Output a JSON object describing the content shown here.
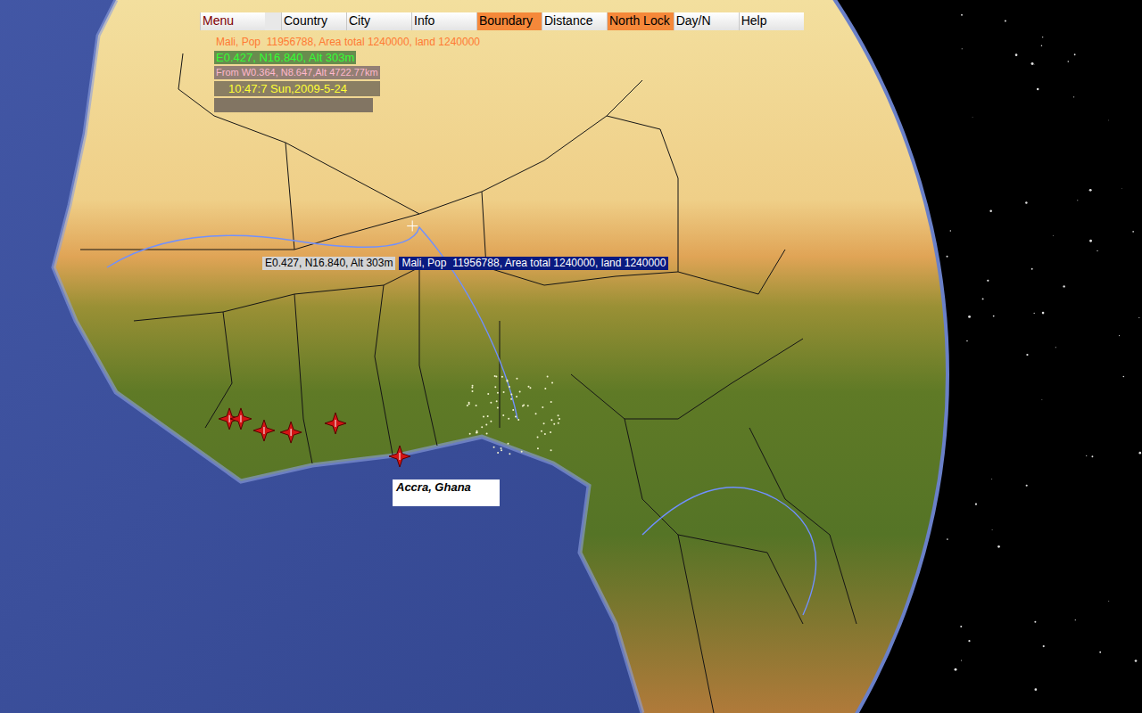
{
  "toolbar": [
    {
      "label": "Menu",
      "kind": "menu",
      "selected": false
    },
    {
      "label": "Country",
      "kind": "toggle",
      "selected": false
    },
    {
      "label": "City",
      "kind": "toggle",
      "selected": false
    },
    {
      "label": "Info",
      "kind": "toggle",
      "selected": false
    },
    {
      "label": "Boundary",
      "kind": "toggle",
      "selected": true
    },
    {
      "label": "Distance",
      "kind": "toggle",
      "selected": false
    },
    {
      "label": "North Lock",
      "kind": "toggle",
      "selected": true
    },
    {
      "label": "Day/N",
      "kind": "toggle",
      "selected": false
    },
    {
      "label": "Help",
      "kind": "toggle",
      "selected": false
    }
  ],
  "info_panel": [
    {
      "kind": "title",
      "text": "Mali, Pop  11956788, Area total 1240000, land 1240000",
      "color": "#ff7a33"
    },
    {
      "kind": "coords",
      "text": "E0.427, N16.840, Alt 303m",
      "color": "#33ff33"
    },
    {
      "kind": "from",
      "text": "From W0.364, N8.647,Alt 4722.77km",
      "color": "#ffb8cc"
    },
    {
      "kind": "time",
      "text": "10:47:7 Sun,2009-5-24",
      "color": "#ffff33"
    }
  ],
  "cursor": {
    "lon": 0.427,
    "lat": 16.84
  },
  "tooltip": {
    "coords": "E0.427, N16.840, Alt 303m",
    "country": "Mali, Pop  11956788, Area total 1240000, land 1240000"
  },
  "pins": [
    {
      "lon": -8.49,
      "lat": 7.43,
      "label": ""
    },
    {
      "lon": -7.93,
      "lat": 7.43,
      "label": ""
    },
    {
      "lon": -6.8,
      "lat": 6.86,
      "label": ""
    },
    {
      "lon": -5.49,
      "lat": 6.77,
      "label": ""
    },
    {
      "lon": -3.32,
      "lat": 7.21,
      "label": ""
    },
    {
      "lon": -0.19,
      "lat": 5.6,
      "label": "Accra, Ghana"
    }
  ]
}
